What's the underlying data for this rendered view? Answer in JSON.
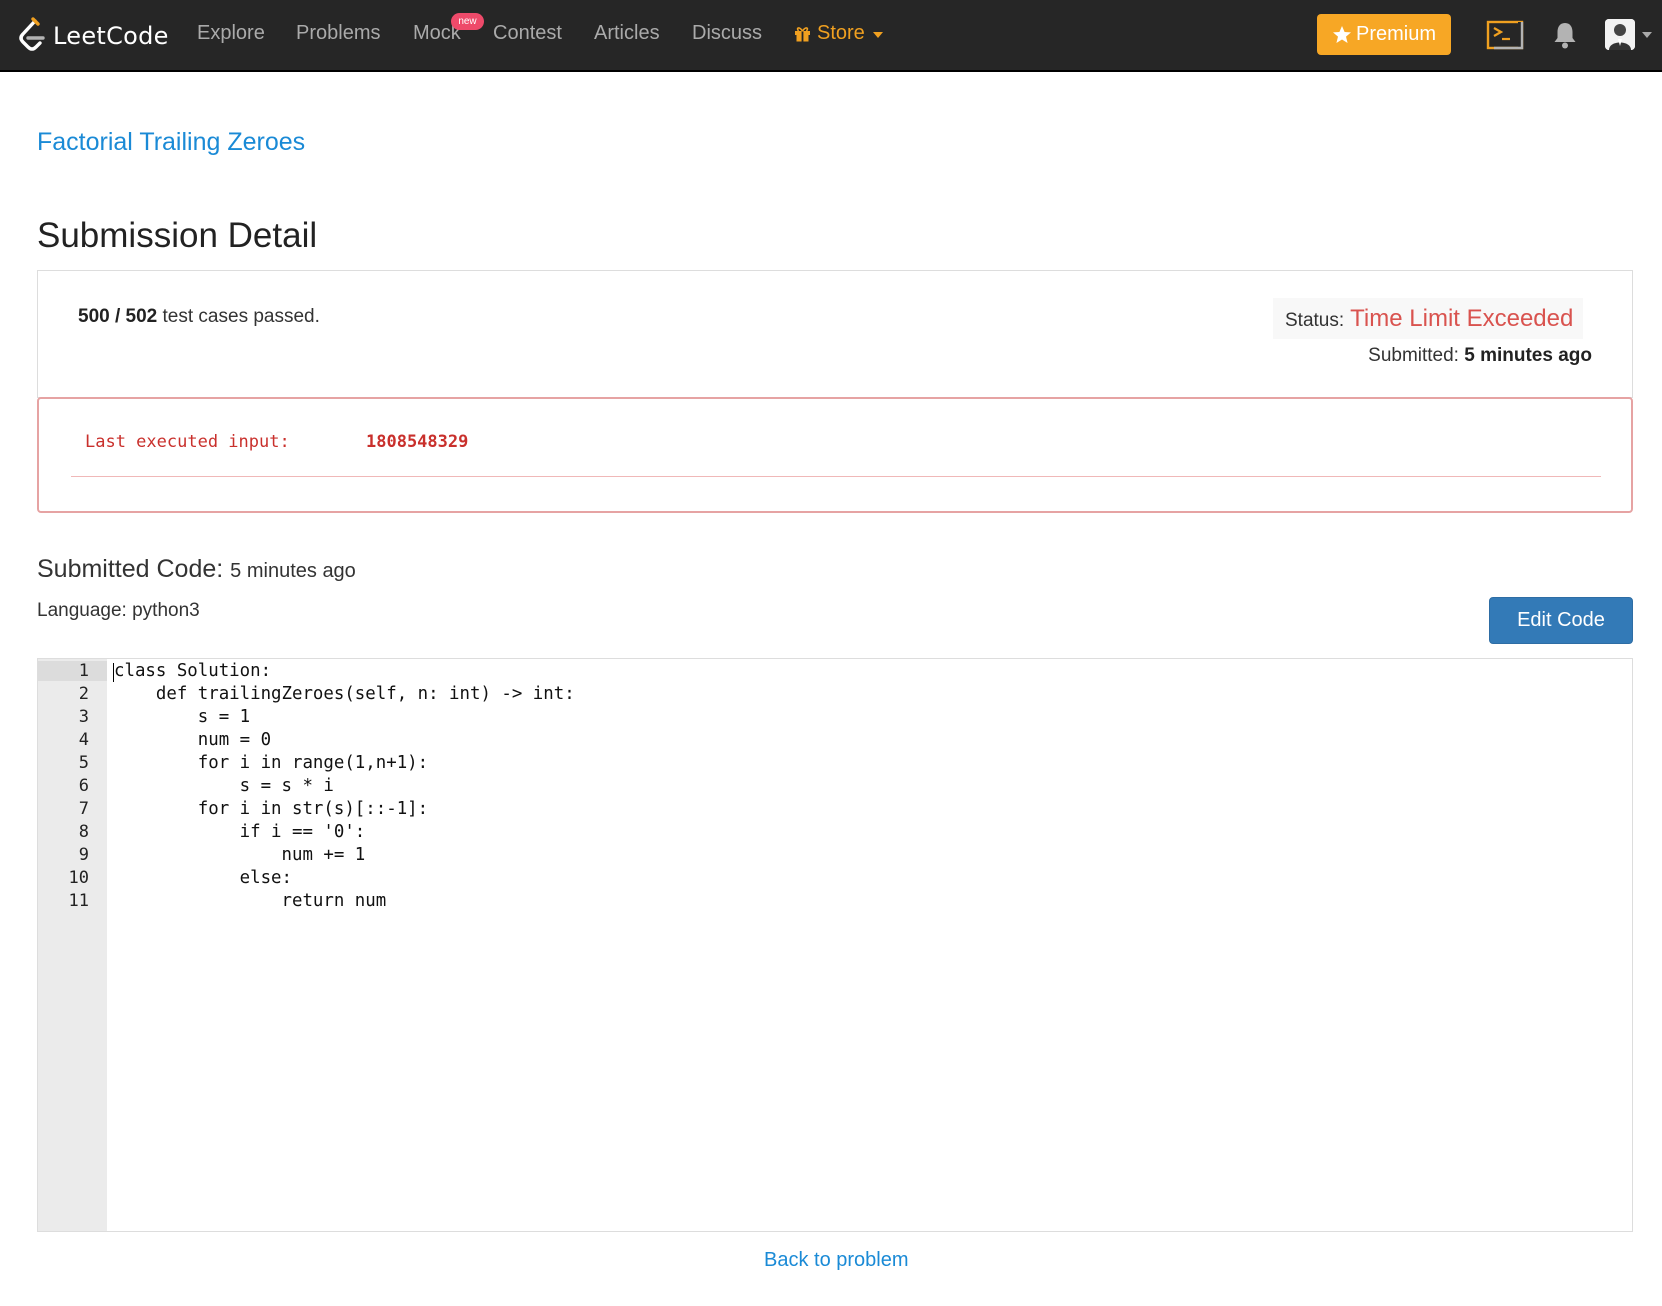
{
  "nav": {
    "brand": "LeetCode",
    "links": [
      "Explore",
      "Problems",
      "Mock",
      "Contest",
      "Articles",
      "Discuss"
    ],
    "new_badge": "new",
    "store": "Store",
    "premium": "Premium",
    "icons": [
      "leetcode-logo-icon",
      "gift-icon",
      "chevron-down-icon",
      "star-icon",
      "console-icon",
      "bell-icon",
      "avatar"
    ]
  },
  "problem": {
    "title": "Factorial Trailing Zeroes"
  },
  "page": {
    "title": "Submission Detail"
  },
  "result": {
    "passed": "500",
    "separator": " / ",
    "total": "502",
    "suffix": " test cases passed.",
    "status_label": "Status:",
    "status": "Time Limit Exceeded",
    "submitted_label": "Submitted:",
    "submitted": "5 minutes ago"
  },
  "error": {
    "label": "Last executed input:",
    "value": "1808548329"
  },
  "code": {
    "heading": "Submitted Code:",
    "time": "5 minutes ago",
    "language_label": "Language:",
    "language": "python3",
    "edit_button": "Edit Code",
    "line_numbers": [
      "1",
      "2",
      "3",
      "4",
      "5",
      "6",
      "7",
      "8",
      "9",
      "10",
      "11"
    ],
    "lines": [
      "class Solution:",
      "    def trailingZeroes(self, n: int) -> int:",
      "        s = 1",
      "        num = 0",
      "        for i in range(1,n+1):",
      "            s = s * i",
      "        for i in str(s)[::-1]:",
      "            if i == '0':",
      "                num += 1",
      "            else:",
      "                return num"
    ]
  },
  "footer": {
    "back_link": "Back to problem"
  },
  "colors": {
    "navbar": "#262626",
    "nav_link": "#aaaaaa",
    "store": "#f0a020",
    "premium": "#f7a725",
    "link": "#1a8ad6",
    "error": "#d9534f",
    "primary_button": "#337ab7"
  }
}
